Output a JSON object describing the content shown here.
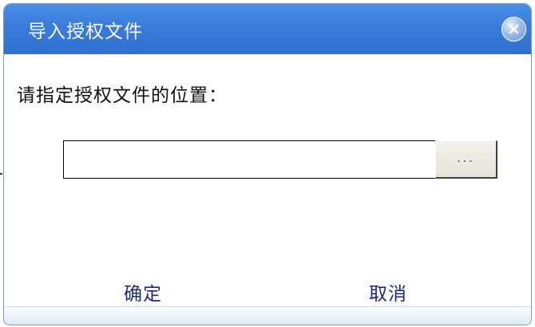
{
  "dialog": {
    "title": "导入授权文件",
    "prompt": "请指定授权文件的位置：",
    "path_value": "",
    "browse_label": "...",
    "ok_label": "确定",
    "cancel_label": "取消"
  },
  "colors": {
    "titlebar": "#3a7ddb",
    "title_text": "#ffffff",
    "button_text": "#1c2a7a",
    "border": "#6f9fd8"
  },
  "icons": {
    "close": "close-icon"
  }
}
